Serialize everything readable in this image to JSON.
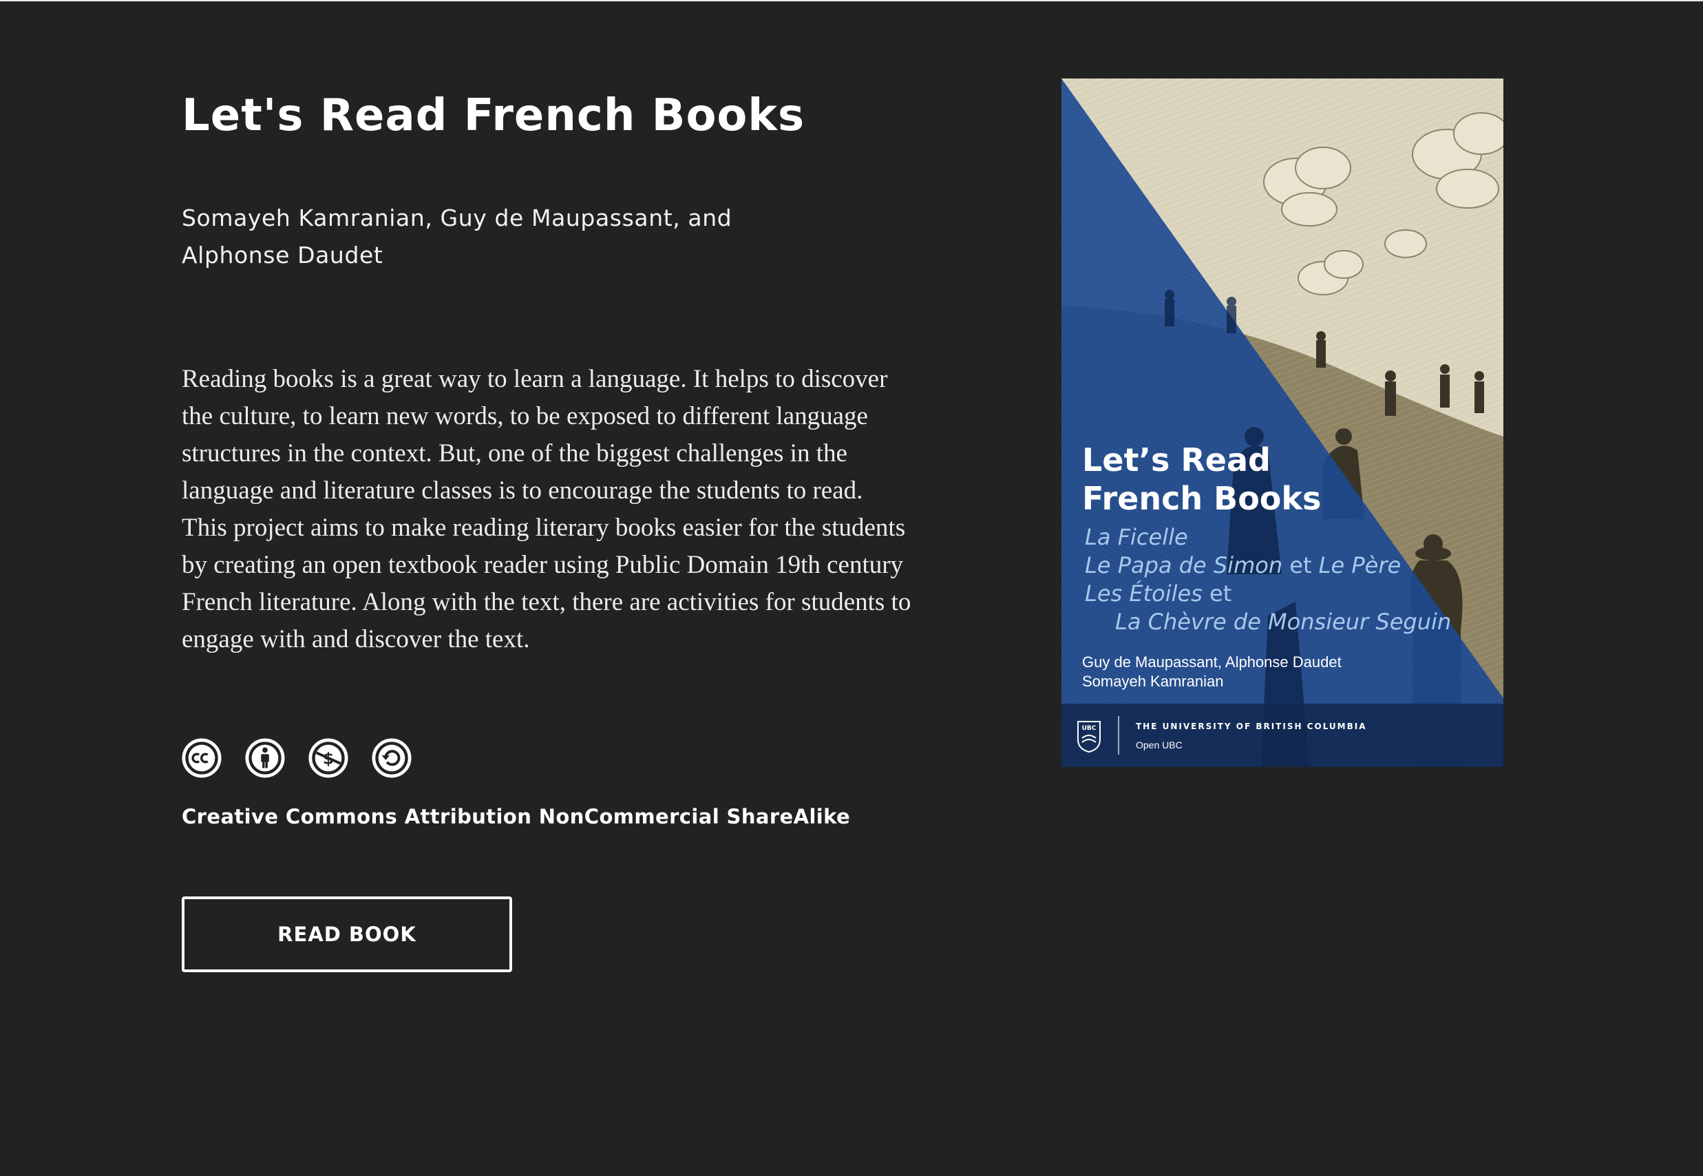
{
  "book": {
    "title": "Let's Read French Books",
    "authors": "Somayeh Kamranian, Guy de Maupassant, and Alphonse Daudet",
    "description": "Reading books is a great way to learn a language. It helps to discover the culture, to learn new words, to be exposed to different language structures in the context. But, one of the biggest challenges in the language and literature classes is to encourage the students to read. This project aims to make reading literary books easier for the students by creating an open textbook reader using Public Domain 19th century French literature. Along with the text, there are activities for students to engage with and discover the text.",
    "license": "Creative Commons Attribution NonCommercial ShareAlike",
    "license_icons": [
      "cc-icon",
      "attribution-icon",
      "noncommercial-icon",
      "sharealike-icon"
    ],
    "read_button_label": "READ BOOK"
  },
  "cover": {
    "title_line1": "Let’s Read",
    "title_line2": "French Books",
    "story1": "La Ficelle",
    "story2a": "Le Papa de Simon",
    "story2b": " et ",
    "story2c": "Le Père",
    "story3a": "Les Étoiles",
    "story3b": " et",
    "story4": "La Chèvre de Monsieur Seguin",
    "authors_line1": "Guy de Maupassant, Alphonse Daudet",
    "authors_line2": "Somayeh Kamranian",
    "logo_text": "UBC",
    "university": "THE UNIVERSITY OF BRITISH COLUMBIA",
    "imprint": "Open UBC"
  },
  "colors": {
    "background": "#222222",
    "text": "#ffffff",
    "cover_blue": "#1d4a94",
    "cover_sepia": "#ddd6bf",
    "cover_story_text": "#a8c8ec"
  }
}
